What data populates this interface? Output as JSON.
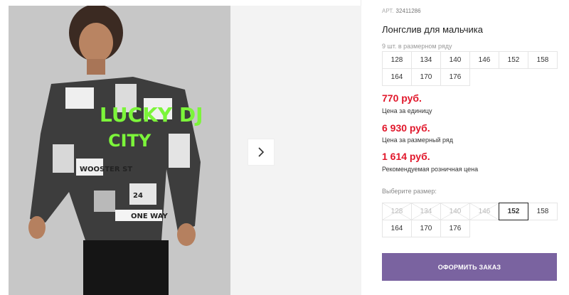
{
  "gallery": {
    "main_photo_alt": "",
    "next_arrow": "chevron-right-icon",
    "shirt_print": {
      "lettering_1": "LUCKY DJ",
      "lettering_2": "CITY",
      "sign_1": "WOOSTER ST",
      "sign_2": "ONE WAY",
      "sign_3": "24"
    }
  },
  "product": {
    "sku_label": "АРТ.",
    "sku": "32411286",
    "title": "Лонгслив для мальчика",
    "row_note": "9 шт. в размерном ряду",
    "row_sizes": [
      "128",
      "134",
      "140",
      "146",
      "152",
      "158",
      "164",
      "170",
      "176"
    ]
  },
  "prices": {
    "unit_price": "770 руб.",
    "unit_label": "Цена за единицу",
    "row_price": "6 930 руб.",
    "row_label": "Цена за размерный ряд",
    "retail_price": "1 614 руб.",
    "retail_label": "Рекомендуемая розничная цена"
  },
  "size_select": {
    "label": "Выберите размер:",
    "options": [
      {
        "size": "128",
        "state": "disabled"
      },
      {
        "size": "134",
        "state": "disabled"
      },
      {
        "size": "140",
        "state": "disabled"
      },
      {
        "size": "146",
        "state": "disabled"
      },
      {
        "size": "152",
        "state": "selected"
      },
      {
        "size": "158",
        "state": "available"
      },
      {
        "size": "164",
        "state": "available"
      },
      {
        "size": "170",
        "state": "available"
      },
      {
        "size": "176",
        "state": "available"
      }
    ]
  },
  "actions": {
    "order_label": "ОФОРМИТЬ ЗАКАЗ"
  },
  "colors": {
    "price": "#e1172b",
    "order_button": "#7a63a0",
    "neon_print": "#7cf53a"
  }
}
